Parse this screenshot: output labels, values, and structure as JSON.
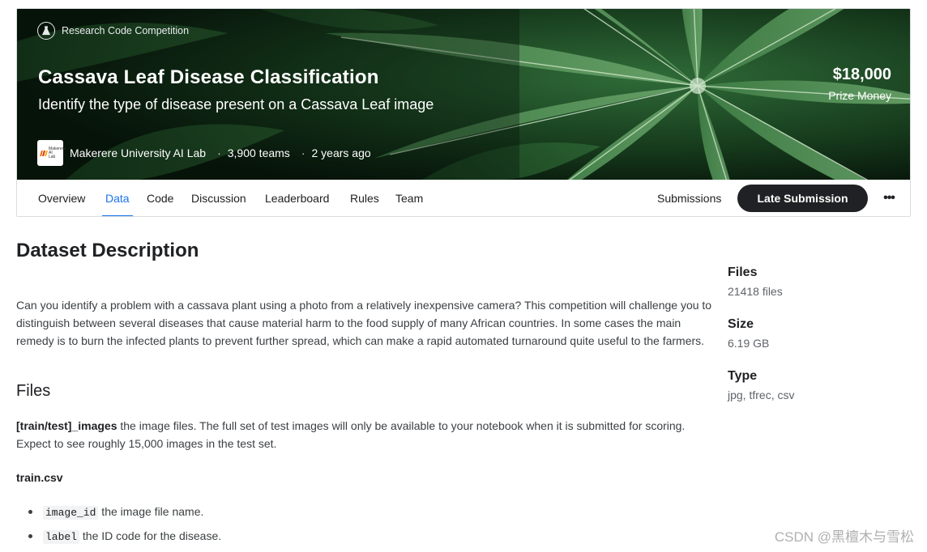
{
  "header": {
    "badge": "Research Code Competition",
    "title": "Cassava Leaf Disease Classification",
    "subtitle": "Identify the type of disease present on a Cassava Leaf image",
    "host_logo_text": "Makerere AI Lab",
    "host": "Makerere University AI Lab",
    "teams": "3,900 teams",
    "age": "2 years ago",
    "prize_amount": "$18,000",
    "prize_label": "Prize Money"
  },
  "tabs": {
    "items": [
      {
        "label": "Overview"
      },
      {
        "label": "Data",
        "active": true
      },
      {
        "label": "Code"
      },
      {
        "label": "Discussion"
      },
      {
        "label": "Leaderboard"
      },
      {
        "label": "Rules"
      },
      {
        "label": "Team"
      }
    ],
    "submissions": "Submissions",
    "late_submission": "Late Submission",
    "more": "•••"
  },
  "main": {
    "title": "Dataset Description",
    "description": "Can you identify a problem with a cassava plant using a photo from a relatively inexpensive camera? This competition will challenge you to distinguish between several diseases that cause material harm to the food supply of many African countries. In some cases the main remedy is to burn the infected plants to prevent further spread, which can make a rapid automated turnaround quite useful to the farmers.",
    "files_heading": "Files",
    "files_bold": "[train/test]_images",
    "files_text": " the image files. The full set of test images will only be available to your notebook when it is submitted for scoring. Expect to see roughly 15,000 images in the test set.",
    "train_heading": "train.csv",
    "columns": [
      {
        "code": "image_id",
        "text": " the image file name."
      },
      {
        "code": "label",
        "text": " the ID code for the disease."
      }
    ]
  },
  "sidebar": {
    "files_label": "Files",
    "files_value": "21418 files",
    "size_label": "Size",
    "size_value": "6.19 GB",
    "type_label": "Type",
    "type_value": "jpg, tfrec, csv"
  },
  "watermark": "CSDN @黑檀木与雪松",
  "colors": {
    "accent": "#1a73e8",
    "button_dark": "#202124",
    "logo_bar_1": "#e8710a",
    "logo_bar_2": "#d93025",
    "logo_bar_3": "#f9ab00"
  }
}
